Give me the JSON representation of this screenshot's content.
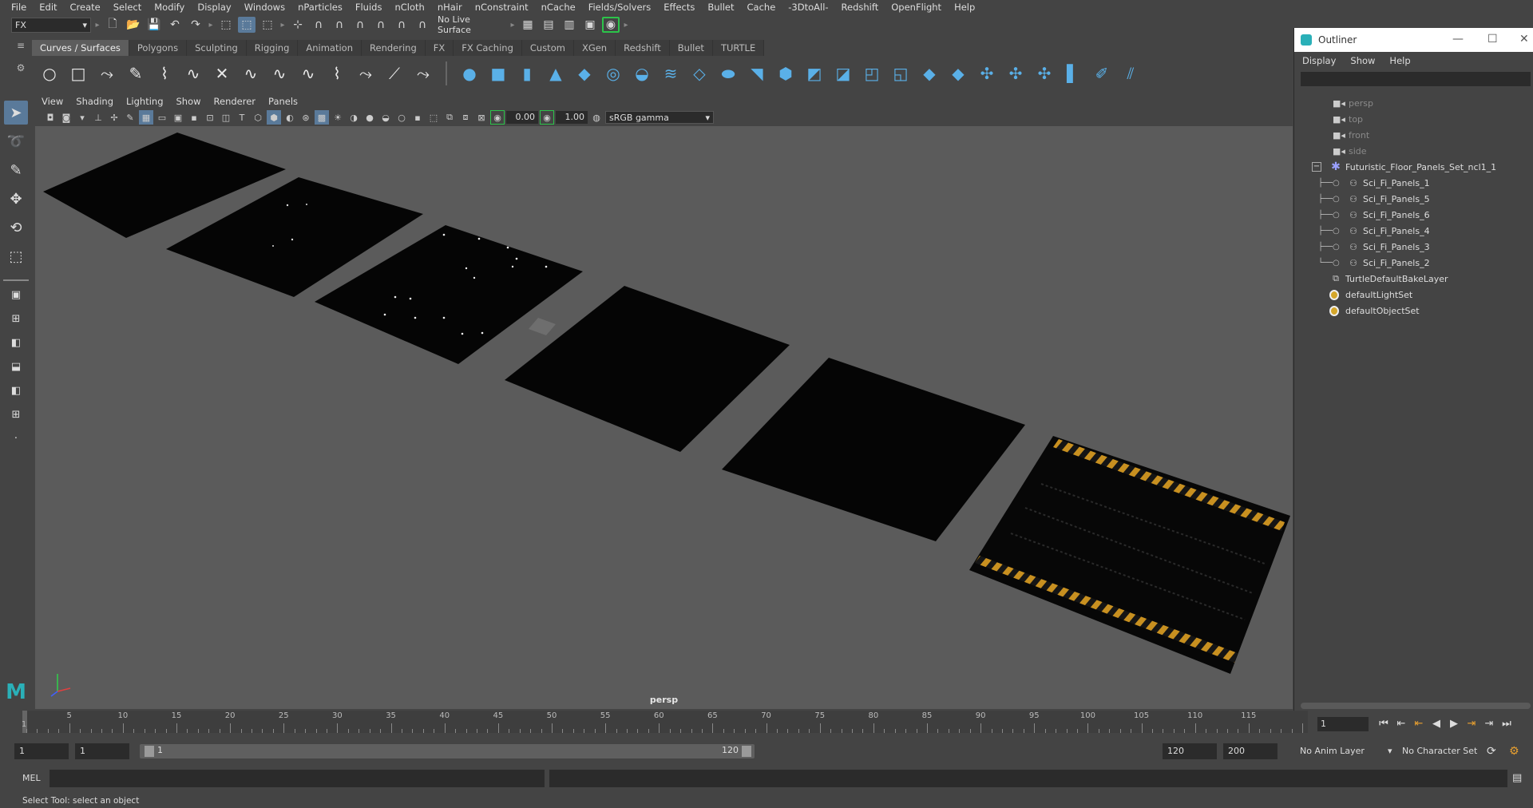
{
  "menubar": {
    "items": [
      "File",
      "Edit",
      "Create",
      "Select",
      "Modify",
      "Display",
      "Windows",
      "nParticles",
      "Fluids",
      "nCloth",
      "nHair",
      "nConstraint",
      "nCache",
      "Fields/Solvers",
      "Effects",
      "Bullet",
      "Cache",
      "-3DtoAll-",
      "Redshift",
      "OpenFlight",
      "Help"
    ]
  },
  "statusline": {
    "menuset": "FX",
    "live_surface": "No Live Surface"
  },
  "shelf": {
    "tabs": [
      "Curves / Surfaces",
      "Polygons",
      "Sculpting",
      "Rigging",
      "Animation",
      "Rendering",
      "FX",
      "FX Caching",
      "Custom",
      "XGen",
      "Redshift",
      "Bullet",
      "TURTLE"
    ],
    "active_tab": "Curves / Surfaces"
  },
  "viewport": {
    "menu": [
      "View",
      "Shading",
      "Lighting",
      "Show",
      "Renderer",
      "Panels"
    ],
    "near_value": "0.00",
    "gamma_value": "1.00",
    "color_space": "sRGB gamma",
    "camera_label": "persp"
  },
  "outliner": {
    "title": "Outliner",
    "menu": [
      "Display",
      "Show",
      "Help"
    ],
    "cameras": [
      "persp",
      "top",
      "front",
      "side"
    ],
    "group_name": "Futuristic_Floor_Panels_Set_ncl1_1",
    "children": [
      "Sci_Fi_Panels_1",
      "Sci_Fi_Panels_5",
      "Sci_Fi_Panels_6",
      "Sci_Fi_Panels_4",
      "Sci_Fi_Panels_3",
      "Sci_Fi_Panels_2"
    ],
    "bake_layer": "TurtleDefaultBakeLayer",
    "sets": [
      "defaultLightSet",
      "defaultObjectSet"
    ]
  },
  "timeline": {
    "tick_labels": [
      "5",
      "10",
      "15",
      "20",
      "25",
      "30",
      "35",
      "40",
      "45",
      "50",
      "55",
      "60",
      "65",
      "70",
      "75",
      "80",
      "85",
      "90",
      "95",
      "100",
      "105",
      "110",
      "115"
    ],
    "start_tick": "1",
    "current_frame": "1"
  },
  "range": {
    "start": "1",
    "inner_start": "1",
    "slider_start": "1",
    "slider_end": "120",
    "end": "120",
    "max_end": "200",
    "anim_layer": "No Anim Layer",
    "character_set": "No Character Set"
  },
  "command": {
    "label": "MEL"
  },
  "help_line": "Select Tool: select an object"
}
